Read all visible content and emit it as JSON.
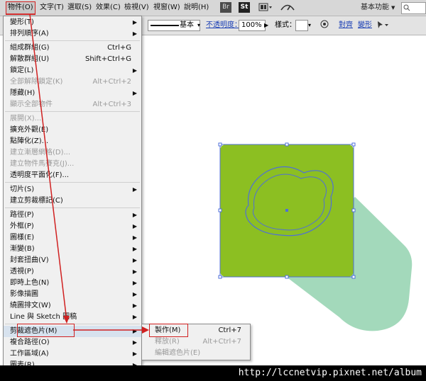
{
  "menubar": {
    "items": [
      "物件(O)",
      "文字(T)",
      "選取(S)",
      "效果(C)",
      "檢視(V)",
      "視窗(W)",
      "說明(H)"
    ],
    "icon_br": "Br",
    "icon_st": "St",
    "workspace_label": "基本功能",
    "workspace_arrow": "▼"
  },
  "controlbar": {
    "stroke_style_label": "基本",
    "opacity_label": "不透明度：",
    "opacity_value": "100%",
    "style_label": "樣式：",
    "align_label": "對齊",
    "transform_label": "變形"
  },
  "object_menu": {
    "items": [
      {
        "label": "變形(T)",
        "shortcut": "",
        "submenu": true,
        "disabled": false
      },
      {
        "label": "排列順序(A)",
        "shortcut": "",
        "submenu": true,
        "disabled": false
      },
      {
        "label": "組成群組(G)",
        "shortcut": "Ctrl+G",
        "submenu": false,
        "disabled": false
      },
      {
        "label": "解散群組(U)",
        "shortcut": "Shift+Ctrl+G",
        "submenu": false,
        "disabled": false
      },
      {
        "label": "鎖定(L)",
        "shortcut": "",
        "submenu": true,
        "disabled": false
      },
      {
        "label": "全部解除鎖定(K)",
        "shortcut": "Alt+Ctrl+2",
        "submenu": false,
        "disabled": true
      },
      {
        "label": "隱藏(H)",
        "shortcut": "",
        "submenu": true,
        "disabled": false
      },
      {
        "label": "顯示全部物件",
        "shortcut": "Alt+Ctrl+3",
        "submenu": false,
        "disabled": true
      },
      {
        "label": "展開(X)...",
        "shortcut": "",
        "submenu": false,
        "disabled": true
      },
      {
        "label": "擴充外觀(E)",
        "shortcut": "",
        "submenu": false,
        "disabled": false
      },
      {
        "label": "點陣化(Z)...",
        "shortcut": "",
        "submenu": false,
        "disabled": false
      },
      {
        "label": "建立漸層網格(D)...",
        "shortcut": "",
        "submenu": false,
        "disabled": true
      },
      {
        "label": "建立物件馬賽克(J)...",
        "shortcut": "",
        "submenu": false,
        "disabled": true
      },
      {
        "label": "透明度平面化(F)...",
        "shortcut": "",
        "submenu": false,
        "disabled": false
      },
      {
        "label": "切片(S)",
        "shortcut": "",
        "submenu": true,
        "disabled": false
      },
      {
        "label": "建立剪裁標記(C)",
        "shortcut": "",
        "submenu": false,
        "disabled": false
      },
      {
        "label": "路徑(P)",
        "shortcut": "",
        "submenu": true,
        "disabled": false
      },
      {
        "label": "外框(P)",
        "shortcut": "",
        "submenu": true,
        "disabled": false
      },
      {
        "label": "圖樣(E)",
        "shortcut": "",
        "submenu": true,
        "disabled": false
      },
      {
        "label": "漸變(B)",
        "shortcut": "",
        "submenu": true,
        "disabled": false
      },
      {
        "label": "封套扭曲(V)",
        "shortcut": "",
        "submenu": true,
        "disabled": false
      },
      {
        "label": "透視(P)",
        "shortcut": "",
        "submenu": true,
        "disabled": false
      },
      {
        "label": "即時上色(N)",
        "shortcut": "",
        "submenu": true,
        "disabled": false
      },
      {
        "label": "影像描圖",
        "shortcut": "",
        "submenu": true,
        "disabled": false
      },
      {
        "label": "繞圖排文(W)",
        "shortcut": "",
        "submenu": true,
        "disabled": false
      },
      {
        "label": "Line 與 Sketch 圖稿",
        "shortcut": "",
        "submenu": true,
        "disabled": false
      },
      {
        "label": "剪裁遮色片(M)",
        "shortcut": "",
        "submenu": true,
        "disabled": false,
        "highlighted": true
      },
      {
        "label": "複合路徑(O)",
        "shortcut": "",
        "submenu": true,
        "disabled": false
      },
      {
        "label": "工作區域(A)",
        "shortcut": "",
        "submenu": true,
        "disabled": false
      },
      {
        "label": "圖表(R)",
        "shortcut": "",
        "submenu": true,
        "disabled": false
      }
    ]
  },
  "clip_submenu": {
    "items": [
      {
        "label": "製作(M)",
        "shortcut": "Ctrl+7",
        "disabled": false
      },
      {
        "label": "釋放(R)",
        "shortcut": "Alt+Ctrl+7",
        "disabled": true
      },
      {
        "label": "編輯遮色片(E)",
        "shortcut": "",
        "disabled": true
      }
    ]
  },
  "colors": {
    "square_fill": "#8cbf22",
    "shadow_fill": "#a3d9bb",
    "selection": "#4f6fd8",
    "annotation": "#d02020"
  },
  "watermark": "http://lccnetvip.pixnet.net/album"
}
